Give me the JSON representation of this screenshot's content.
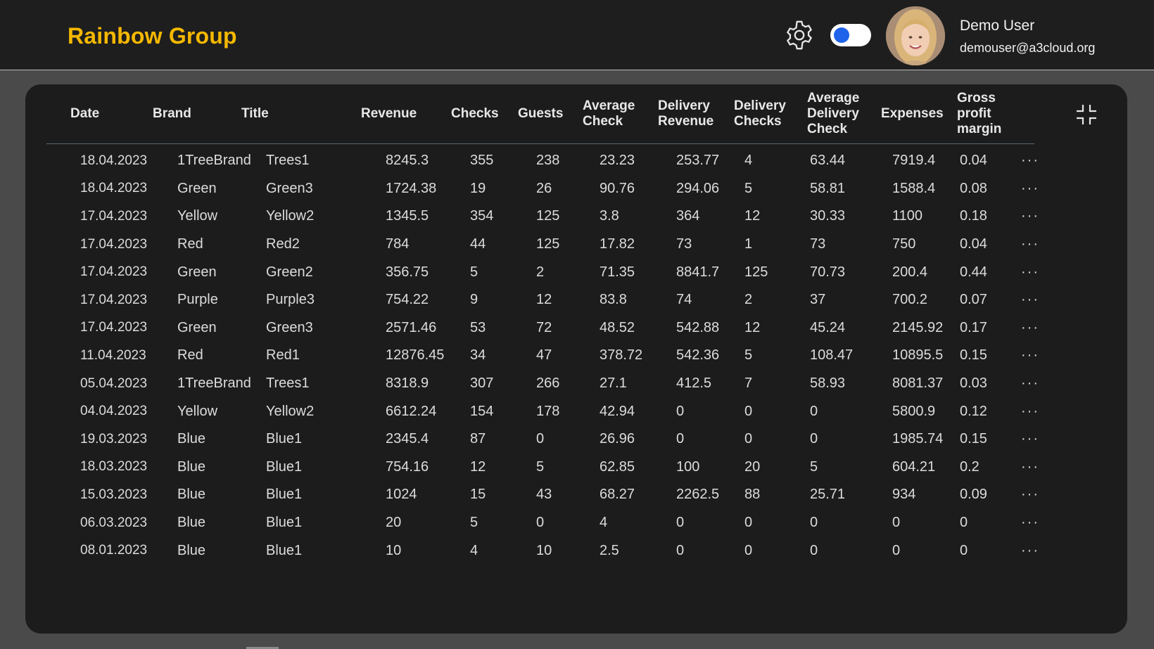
{
  "header": {
    "brand": "Rainbow Group",
    "user_name": "Demo User",
    "user_email": "demouser@a3cloud.org",
    "toggle_on": true,
    "colors": {
      "brand": "#f5b800",
      "toggle_knob": "#1e63ea"
    }
  },
  "table": {
    "columns": [
      "Date",
      "Brand",
      "Title",
      "Revenue",
      "Checks",
      "Guests",
      "Average Check",
      "Delivery Revenue",
      "Delivery Checks",
      "Average Delivery Check",
      "Expenses",
      "Gross profit margin"
    ],
    "rows": [
      [
        "18.04.2023",
        "1TreeBrand",
        "Trees1",
        "8245.3",
        "355",
        "238",
        "23.23",
        "253.77",
        "4",
        "63.44",
        "7919.4",
        "0.04"
      ],
      [
        "18.04.2023",
        "Green",
        "Green3",
        "1724.38",
        "19",
        "26",
        "90.76",
        "294.06",
        "5",
        "58.81",
        "1588.4",
        "0.08"
      ],
      [
        "17.04.2023",
        "Yellow",
        "Yellow2",
        "1345.5",
        "354",
        "125",
        "3.8",
        "364",
        "12",
        "30.33",
        "1100",
        "0.18"
      ],
      [
        "17.04.2023",
        "Red",
        "Red2",
        "784",
        "44",
        "125",
        "17.82",
        "73",
        "1",
        "73",
        "750",
        "0.04"
      ],
      [
        "17.04.2023",
        "Green",
        "Green2",
        "356.75",
        "5",
        "2",
        "71.35",
        "8841.7",
        "125",
        "70.73",
        "200.4",
        "0.44"
      ],
      [
        "17.04.2023",
        "Purple",
        "Purple3",
        "754.22",
        "9",
        "12",
        "83.8",
        "74",
        "2",
        "37",
        "700.2",
        "0.07"
      ],
      [
        "17.04.2023",
        "Green",
        "Green3",
        "2571.46",
        "53",
        "72",
        "48.52",
        "542.88",
        "12",
        "45.24",
        "2145.92",
        "0.17"
      ],
      [
        "11.04.2023",
        "Red",
        "Red1",
        "12876.45",
        "34",
        "47",
        "378.72",
        "542.36",
        "5",
        "108.47",
        "10895.5",
        "0.15"
      ],
      [
        "05.04.2023",
        "1TreeBrand",
        "Trees1",
        "8318.9",
        "307",
        "266",
        "27.1",
        "412.5",
        "7",
        "58.93",
        "8081.37",
        "0.03"
      ],
      [
        "04.04.2023",
        "Yellow",
        "Yellow2",
        "6612.24",
        "154",
        "178",
        "42.94",
        "0",
        "0",
        "0",
        "5800.9",
        "0.12"
      ],
      [
        "19.03.2023",
        "Blue",
        "Blue1",
        "2345.4",
        "87",
        "0",
        "26.96",
        "0",
        "0",
        "0",
        "1985.74",
        "0.15"
      ],
      [
        "18.03.2023",
        "Blue",
        "Blue1",
        "754.16",
        "12",
        "5",
        "62.85",
        "100",
        "20",
        "5",
        "604.21",
        "0.2"
      ],
      [
        "15.03.2023",
        "Blue",
        "Blue1",
        "1024",
        "15",
        "43",
        "68.27",
        "2262.5",
        "88",
        "25.71",
        "934",
        "0.09"
      ],
      [
        "06.03.2023",
        "Blue",
        "Blue1",
        "20",
        "5",
        "0",
        "4",
        "0",
        "0",
        "0",
        "0",
        "0"
      ],
      [
        "08.01.2023",
        "Blue",
        "Blue1",
        "10",
        "4",
        "10",
        "2.5",
        "0",
        "0",
        "0",
        "0",
        "0"
      ]
    ],
    "row_menu_label": "···"
  },
  "icons": {
    "settings": "gear-icon",
    "collapse": "collapse-icon",
    "avatar": "user-avatar"
  }
}
